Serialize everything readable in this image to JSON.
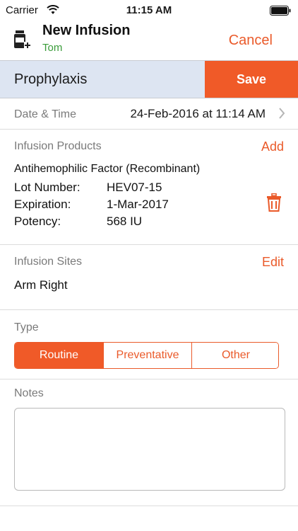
{
  "status_bar": {
    "carrier": "Carrier",
    "time": "11:15 AM",
    "icons": [
      "wifi-icon",
      "battery-icon"
    ]
  },
  "nav": {
    "title": "New Infusion",
    "subtitle": "Tom",
    "cancel_label": "Cancel",
    "logo_icon": "medicine-bottle-add-icon"
  },
  "mode_bar": {
    "label": "Prophylaxis",
    "save_label": "Save"
  },
  "date_time": {
    "label": "Date & Time",
    "value": "24-Feb-2016 at 11:14 AM"
  },
  "infusion_products": {
    "heading": "Infusion Products",
    "add_label": "Add",
    "product_name": "Antihemophilic Factor (Recombinant)",
    "fields": [
      {
        "label": "Lot Number:",
        "value": "HEV07-15"
      },
      {
        "label": "Expiration:",
        "value": "1-Mar-2017"
      },
      {
        "label": "Potency:",
        "value": "568 IU"
      }
    ]
  },
  "infusion_sites": {
    "heading": "Infusion Sites",
    "edit_label": "Edit",
    "value": "Arm Right"
  },
  "type": {
    "heading": "Type",
    "options": [
      "Routine",
      "Preventative",
      "Other"
    ],
    "selected": "Routine"
  },
  "notes": {
    "heading": "Notes",
    "value": ""
  },
  "colors": {
    "accent": "#f05a28",
    "subtitle_green": "#3a9c3a",
    "mode_bar_bg": "#dde5f2"
  }
}
